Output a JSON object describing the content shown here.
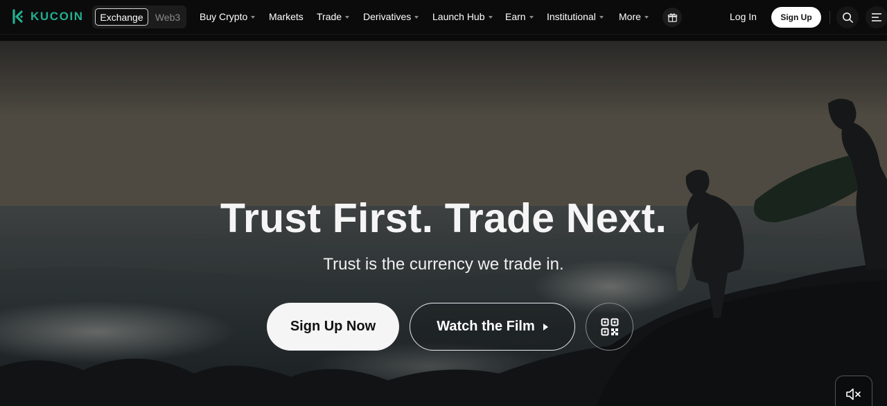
{
  "brand": {
    "name": "KUCOIN",
    "color": "#23af91"
  },
  "mode_switch": {
    "active": "Exchange",
    "inactive": "Web3"
  },
  "menu": [
    {
      "label": "Buy Crypto",
      "has_dropdown": true
    },
    {
      "label": "Markets",
      "has_dropdown": false
    },
    {
      "label": "Trade",
      "has_dropdown": true
    },
    {
      "label": "Derivatives",
      "has_dropdown": true
    },
    {
      "label": "Launch Hub",
      "has_dropdown": true
    },
    {
      "label": "Earn",
      "has_dropdown": true
    },
    {
      "label": "Institutional",
      "has_dropdown": true
    },
    {
      "label": "More",
      "has_dropdown": true
    }
  ],
  "nav_actions": {
    "login": "Log In",
    "signup": "Sign Up"
  },
  "icons": {
    "gift": "gift-icon",
    "search": "search-icon",
    "menu": "hamburger-menu-icon",
    "qr": "qr-code-icon",
    "mute": "speaker-muted-icon",
    "play": "play-icon"
  },
  "hero": {
    "headline": "Trust First. Trade Next.",
    "subline": "Trust is the currency we trade in.",
    "cta_primary": "Sign Up Now",
    "cta_secondary": "Watch the Film"
  }
}
